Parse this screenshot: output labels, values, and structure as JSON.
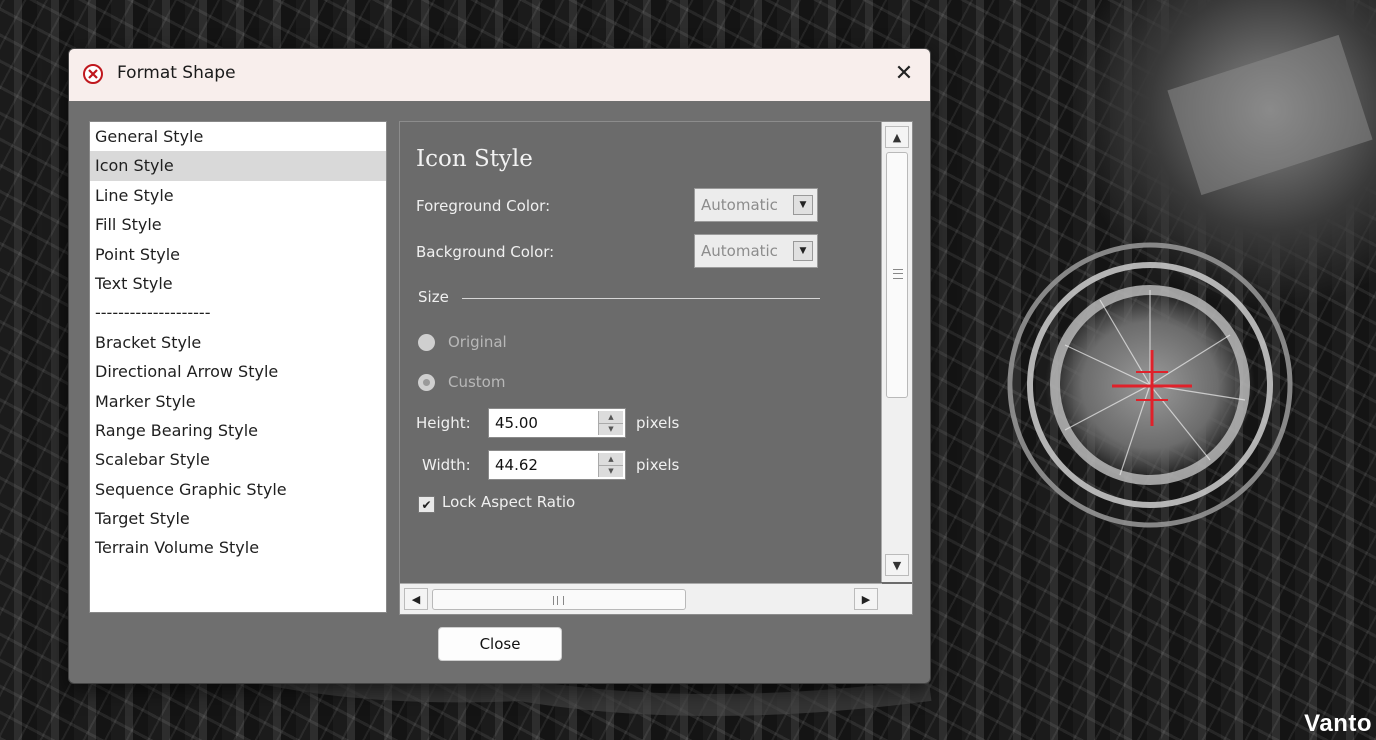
{
  "dialog": {
    "title": "Format Shape",
    "close_glyph": "✕"
  },
  "style_list": [
    "General Style",
    "Icon Style",
    "Line Style",
    "Fill Style",
    "Point Style",
    "Text Style",
    "--------------------",
    "Bracket Style",
    "Directional Arrow Style",
    "Marker Style",
    "Range Bearing Style",
    "Scalebar Style",
    "Sequence Graphic Style",
    "Target Style",
    "Terrain Volume Style"
  ],
  "selected_style": "Icon Style",
  "panel": {
    "heading": "Icon Style",
    "foreground_label": "Foreground Color:",
    "foreground_value": "Automatic",
    "background_label": "Background Color:",
    "background_value": "Automatic",
    "size_label": "Size",
    "original_label": "Original",
    "custom_label": "Custom",
    "height_label": "Height:",
    "height_value": "45.00",
    "width_label": "Width:",
    "width_value": "44.62",
    "unit_label": "pixels",
    "lock_label": "Lock Aspect Ratio",
    "lock_checked": true
  },
  "close_button_label": "Close",
  "watermark": "Vanto",
  "colors": {
    "marker": "#e0212a",
    "dialog_bg": "#6f6f6f",
    "titlebar": "#f8eeec"
  }
}
